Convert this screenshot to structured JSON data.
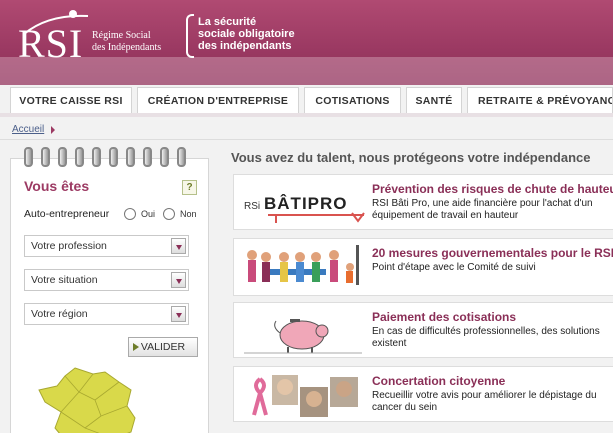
{
  "header": {
    "logo_text": "RSI",
    "logo_subtitle_1": "Régime Social",
    "logo_subtitle_2": "des Indépendants",
    "tagline_1": "La sécurité",
    "tagline_2": "sociale obligatoire",
    "tagline_3": "des indépendants"
  },
  "nav": {
    "tabs": [
      {
        "label": "VOTRE CAISSE RSI"
      },
      {
        "label": "CRÉATION D'ENTREPRISE"
      },
      {
        "label": "COTISATIONS"
      },
      {
        "label": "SANTÉ"
      },
      {
        "label": "RETRAITE & PRÉVOYANCE"
      }
    ]
  },
  "breadcrumb": {
    "home": "Accueil"
  },
  "sidebar": {
    "title": "Vous êtes",
    "help": "?",
    "auto_label": "Auto-entrepreneur",
    "oui": "Oui",
    "non": "Non",
    "selects": [
      {
        "value": "Votre profession"
      },
      {
        "value": "Votre situation"
      },
      {
        "value": "Votre région"
      }
    ],
    "submit": "VALIDER"
  },
  "main": {
    "title": "Vous avez du talent, nous protégeons votre indépendance",
    "cards": [
      {
        "title": "Prévention des risques de chute de hauteur",
        "desc": "RSI Bâti Pro, une aide financière pour l'achat d'un équipement de travail en hauteur",
        "image_label_1": "RSi",
        "image_label_2": "BÂTIPRO"
      },
      {
        "title": "20 mesures gouvernementales pour le RSI",
        "desc": "Point d'étape avec le Comité de suivi"
      },
      {
        "title": "Paiement des cotisations",
        "desc": "En cas de difficultés professionnelles, des solutions existent"
      },
      {
        "title": "Concertation citoyenne",
        "desc": "Recueillir votre avis pour améliorer le dépistage du cancer du sein"
      }
    ]
  },
  "colors": {
    "brand": "#9c3a63",
    "accent_green": "#6e7d2a",
    "link": "#4b5f8a"
  }
}
